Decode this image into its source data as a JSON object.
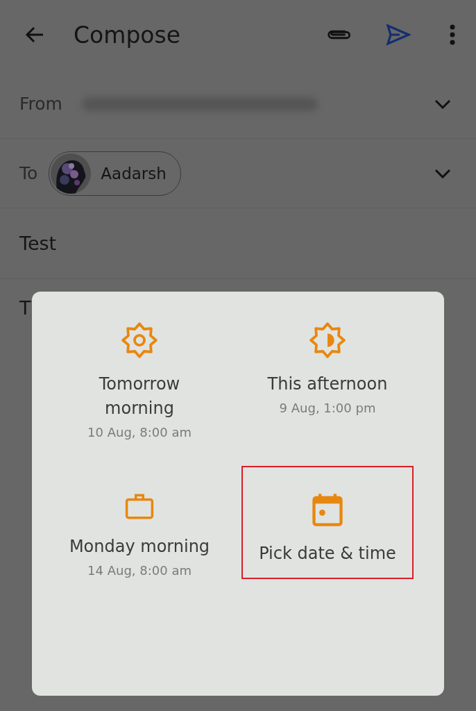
{
  "app_bar": {
    "title": "Compose"
  },
  "from": {
    "label": "From"
  },
  "to": {
    "label": "To",
    "recipients": [
      {
        "name": "Aadarsh"
      }
    ]
  },
  "subject": "Test",
  "body": "T",
  "schedule_options": [
    {
      "kind": "sun",
      "title": "Tomorrow morning",
      "subtitle": "10 Aug, 8:00 am",
      "highlighted": false
    },
    {
      "kind": "half-sun",
      "title": "This afternoon",
      "subtitle": "9 Aug, 1:00 pm",
      "highlighted": false
    },
    {
      "kind": "briefcase",
      "title": "Monday morning",
      "subtitle": "14 Aug, 8:00 am",
      "highlighted": false
    },
    {
      "kind": "calendar",
      "title": "Pick date & time",
      "highlighted": true
    }
  ]
}
